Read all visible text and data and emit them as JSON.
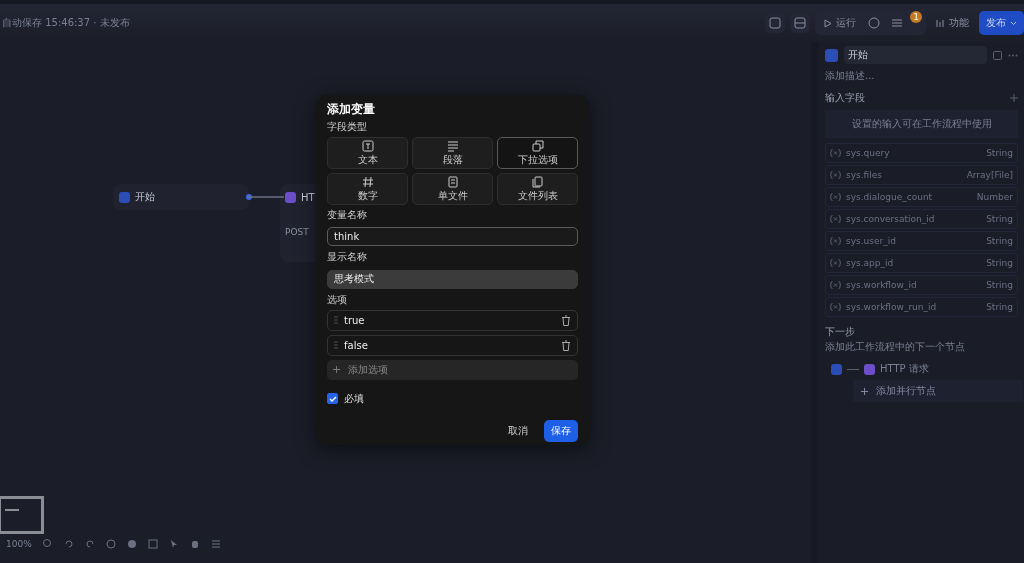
{
  "header": {
    "status": "自动保存 15:46:37 · 未发布",
    "run": "运行",
    "features": "功能",
    "publish": "发布",
    "badge": "1"
  },
  "canvas": {
    "nodes": [
      {
        "kind": "start",
        "title": "开始"
      },
      {
        "kind": "http",
        "title": "HT",
        "method": "POST"
      }
    ],
    "zoom": "100%"
  },
  "dialog": {
    "title": "添加变量",
    "type_label": "字段类型",
    "types": [
      {
        "kind": "text",
        "label": "文本",
        "selected": false
      },
      {
        "kind": "paragraph",
        "label": "段落",
        "selected": false
      },
      {
        "kind": "select",
        "label": "下拉选项",
        "selected": true
      },
      {
        "kind": "number",
        "label": "数字",
        "selected": false
      },
      {
        "kind": "file",
        "label": "单文件",
        "selected": false
      },
      {
        "kind": "files",
        "label": "文件列表",
        "selected": false
      }
    ],
    "name_label": "变量名称",
    "name_value": "think",
    "display_label": "显示名称",
    "display_value": "思考模式",
    "options_label": "选项",
    "options": [
      "true",
      "false"
    ],
    "add_option": "添加选项",
    "required": {
      "label": "必填",
      "checked": true
    },
    "cancel": "取消",
    "save": "保存"
  },
  "panel": {
    "title": "开始",
    "description": "添加描述...",
    "inputs_title": "输入字段",
    "inputs_hint": "设置的输入可在工作流程中使用",
    "vars": [
      {
        "name": "sys.query",
        "type": "String"
      },
      {
        "name": "sys.files",
        "type": "Array[File]"
      },
      {
        "name": "sys.dialogue_count",
        "type": "Number"
      },
      {
        "name": "sys.conversation_id",
        "type": "String"
      },
      {
        "name": "sys.user_id",
        "type": "String"
      },
      {
        "name": "sys.app_id",
        "type": "String"
      },
      {
        "name": "sys.workflow_id",
        "type": "String"
      },
      {
        "name": "sys.workflow_run_id",
        "type": "String"
      }
    ],
    "next_title": "下一步",
    "next_hint": "添加此工作流程中的下一个节点",
    "next_node": "HTTP 请求",
    "add_parallel": "添加并行节点"
  }
}
